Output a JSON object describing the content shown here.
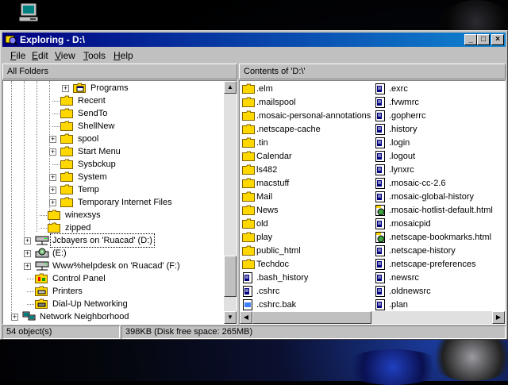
{
  "window": {
    "title": "Exploring - D:\\"
  },
  "menu": [
    "File",
    "Edit",
    "View",
    "Tools",
    "Help"
  ],
  "menu_underline": [
    "F",
    "E",
    "V",
    "T",
    "H"
  ],
  "left_header": "All Folders",
  "right_header": "Contents of 'D:\\'",
  "tree": [
    {
      "label": "Programs",
      "level": 5,
      "pm": "+",
      "icon": "programs"
    },
    {
      "label": "Recent",
      "level": 4,
      "pm": "",
      "icon": "folder"
    },
    {
      "label": "SendTo",
      "level": 4,
      "pm": "",
      "icon": "folder"
    },
    {
      "label": "ShellNew",
      "level": 4,
      "pm": "",
      "icon": "folder"
    },
    {
      "label": "spool",
      "level": 4,
      "pm": "+",
      "icon": "folder"
    },
    {
      "label": "Start Menu",
      "level": 4,
      "pm": "+",
      "icon": "folder"
    },
    {
      "label": "Sysbckup",
      "level": 4,
      "pm": "",
      "icon": "folder"
    },
    {
      "label": "System",
      "level": 4,
      "pm": "+",
      "icon": "folder"
    },
    {
      "label": "Temp",
      "level": 4,
      "pm": "+",
      "icon": "folder"
    },
    {
      "label": "Temporary Internet Files",
      "level": 4,
      "pm": "+",
      "icon": "folder"
    },
    {
      "label": "winexsys",
      "level": 3,
      "pm": "",
      "icon": "folder"
    },
    {
      "label": "zipped",
      "level": 3,
      "pm": "",
      "icon": "folder"
    },
    {
      "label": "Jcbayers on 'Ruacad' (D:)",
      "level": 2,
      "pm": "+",
      "icon": "netdrive",
      "selected": true
    },
    {
      "label": "(E:)",
      "level": 2,
      "pm": "+",
      "icon": "cdrom"
    },
    {
      "label": "Www%helpdesk on 'Ruacad' (F:)",
      "level": 2,
      "pm": "+",
      "icon": "netdrive"
    },
    {
      "label": "Control Panel",
      "level": 2,
      "pm": "",
      "icon": "controlpanel"
    },
    {
      "label": "Printers",
      "level": 2,
      "pm": "",
      "icon": "printers"
    },
    {
      "label": "Dial-Up Networking",
      "level": 2,
      "pm": "",
      "icon": "dialup"
    },
    {
      "label": "Network Neighborhood",
      "level": 1,
      "pm": "+",
      "icon": "network"
    }
  ],
  "files_col1": [
    {
      "name": ".elm",
      "type": "folder"
    },
    {
      "name": ".mailspool",
      "type": "folder"
    },
    {
      "name": ".mosaic-personal-annotations",
      "type": "folder"
    },
    {
      "name": ".netscape-cache",
      "type": "folder"
    },
    {
      "name": ".tin",
      "type": "folder"
    },
    {
      "name": "Calendar",
      "type": "folder"
    },
    {
      "name": "ls482",
      "type": "folder"
    },
    {
      "name": "macstuff",
      "type": "folder"
    },
    {
      "name": "Mail",
      "type": "folder"
    },
    {
      "name": "News",
      "type": "folder"
    },
    {
      "name": "old",
      "type": "folder"
    },
    {
      "name": "play",
      "type": "folder"
    },
    {
      "name": "public_html",
      "type": "folder"
    },
    {
      "name": "Techdoc",
      "type": "folder"
    },
    {
      "name": ".bash_history",
      "type": "file"
    },
    {
      "name": ".cshrc",
      "type": "file"
    },
    {
      "name": ".cshrc.bak",
      "type": "bak"
    }
  ],
  "files_col2": [
    {
      "name": ".exrc",
      "type": "file"
    },
    {
      "name": ".fvwmrc",
      "type": "file"
    },
    {
      "name": ".gopherrc",
      "type": "file"
    },
    {
      "name": ".history",
      "type": "file"
    },
    {
      "name": ".login",
      "type": "file"
    },
    {
      "name": ".logout",
      "type": "file"
    },
    {
      "name": ".lynxrc",
      "type": "file"
    },
    {
      "name": ".mosaic-cc-2.6",
      "type": "file"
    },
    {
      "name": ".mosaic-global-history",
      "type": "file"
    },
    {
      "name": ".mosaic-hotlist-default.html",
      "type": "html"
    },
    {
      "name": ".mosaicpid",
      "type": "file"
    },
    {
      "name": ".netscape-bookmarks.html",
      "type": "html"
    },
    {
      "name": ".netscape-history",
      "type": "file"
    },
    {
      "name": ".netscape-preferences",
      "type": "file"
    },
    {
      "name": ".newsrc",
      "type": "file"
    },
    {
      "name": ".oldnewsrc",
      "type": "file"
    },
    {
      "name": ".plan",
      "type": "file"
    }
  ],
  "status": {
    "objects": "54 object(s)",
    "size": "398KB (Disk free space: 265MB)"
  },
  "colors": {
    "title_start": "#000080",
    "title_end": "#1084d0",
    "folder": "#ffd800",
    "face": "#c0c0c0"
  }
}
